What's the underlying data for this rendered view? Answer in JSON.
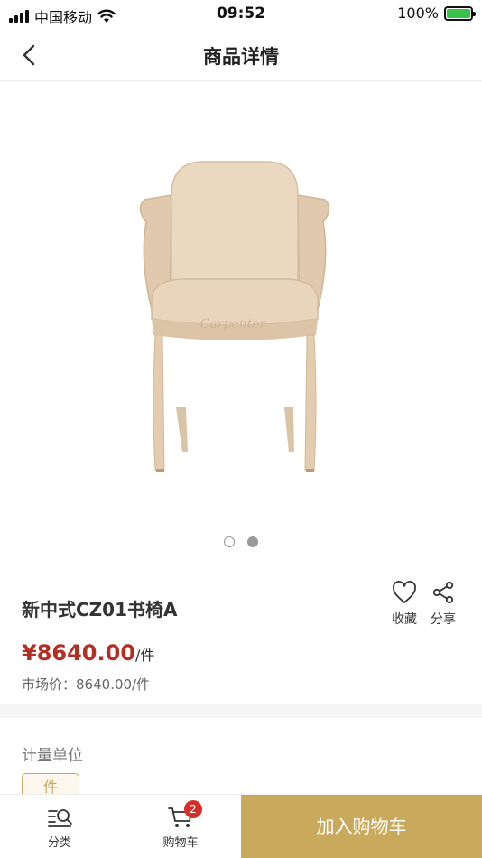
{
  "status_bar": {
    "carrier": "中国移动",
    "time": "09:52",
    "battery": "100%"
  },
  "header": {
    "title": "商品详情"
  },
  "gallery": {
    "image_count": 2,
    "active_index": 1,
    "watermark": "Carpenter"
  },
  "product": {
    "name": "新中式CZ01书椅A",
    "price": "¥8640.00",
    "price_unit": "/件",
    "market_price": "市场价：8640.00/件",
    "favorite_label": "收藏",
    "share_label": "分享"
  },
  "spec": {
    "label": "计量单位",
    "option": "件"
  },
  "bottom_bar": {
    "category_label": "分类",
    "cart_label": "购物车",
    "cart_count": "2",
    "add_to_cart_label": "加入购物车"
  },
  "colors": {
    "accent_gold": "#c9a95c",
    "price_red": "#b22f24",
    "badge_red": "#d3302a",
    "battery_green": "#39c24a"
  }
}
